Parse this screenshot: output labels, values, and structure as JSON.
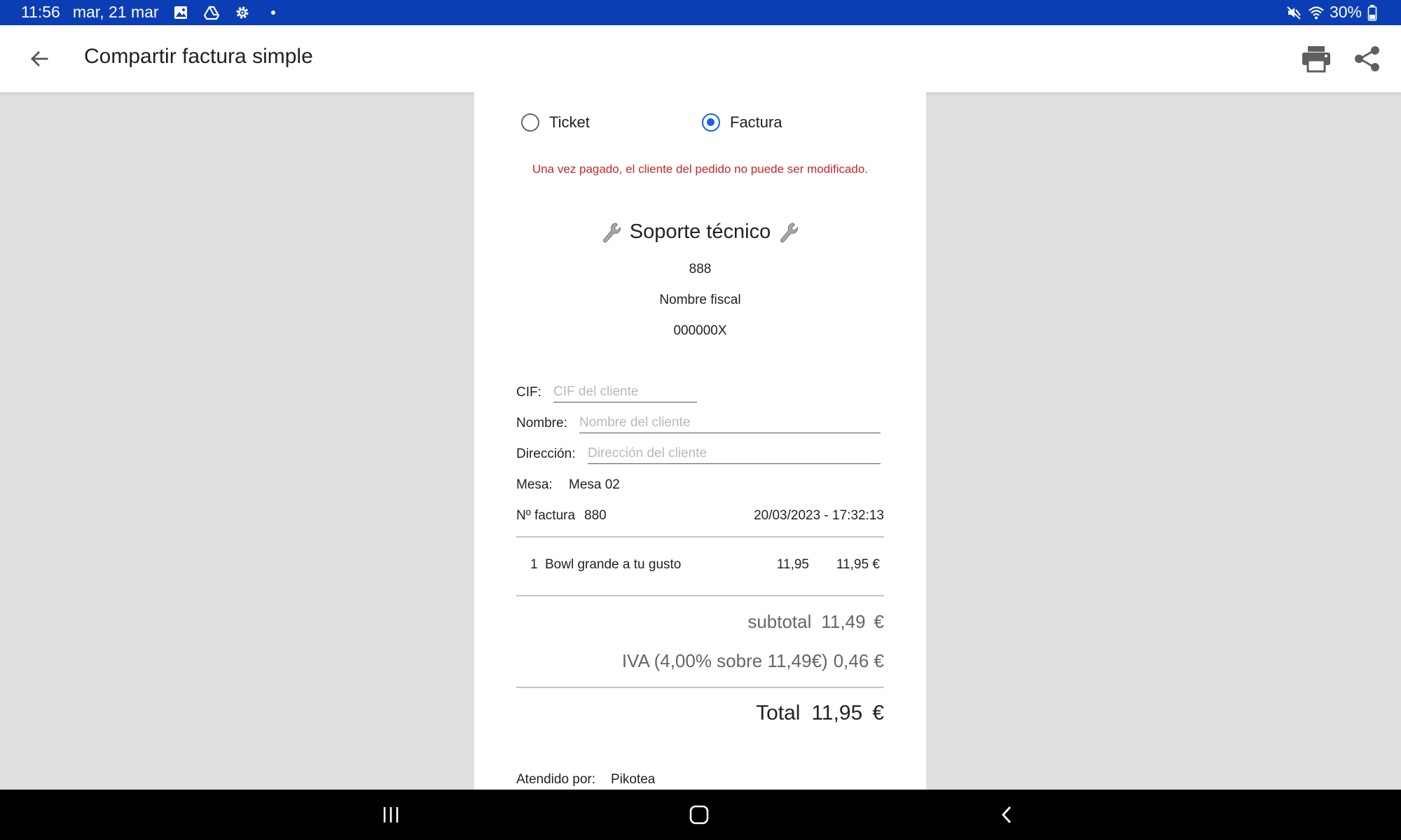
{
  "status_bar": {
    "time": "11:56",
    "date": "mar, 21 mar",
    "battery": "30%",
    "icons": [
      "image-icon",
      "drive-icon",
      "settings-icon",
      "dot-icon",
      "mute-icon",
      "wifi-icon",
      "battery-icon"
    ]
  },
  "app_bar": {
    "title": "Compartir factura simple",
    "back_icon": "arrow-back-icon",
    "print_icon": "print-icon",
    "share_icon": "share-icon"
  },
  "receipt": {
    "type_options": [
      {
        "label": "Ticket",
        "selected": false
      },
      {
        "label": "Factura",
        "selected": true
      }
    ],
    "warning": "Una vez pagado, el cliente del pedido no puede ser modificado.",
    "business_name": "Soporte técnico",
    "business_icon": "wrench-icon",
    "business_code": "888",
    "fiscal_name": "Nombre fiscal",
    "tax_id": "000000X",
    "fields": {
      "cif_label": "CIF:",
      "cif_placeholder": "CIF del cliente",
      "cif_value": "",
      "name_label": "Nombre:",
      "name_placeholder": "Nombre del cliente",
      "name_value": "",
      "address_label": "Dirección:",
      "address_placeholder": "Dirección del cliente",
      "address_value": ""
    },
    "table_label": "Mesa:",
    "table_value": "Mesa 02",
    "invoice_label": "Nº factura",
    "invoice_number": "880",
    "datetime": "20/03/2023 - 17:32:13",
    "items": [
      {
        "qty": "1",
        "name": "Bowl grande a tu gusto",
        "unit_price": "11,95",
        "total": "11,95 €"
      }
    ],
    "subtotal_label": "subtotal",
    "subtotal_value": "11,49",
    "currency": "€",
    "tax_label": "IVA (4,00% sobre 11,49€)",
    "tax_value": "0,46 €",
    "total_label": "Total",
    "total_value": "11,95",
    "served_by_label": "Atendido por:",
    "served_by_value": "Pikotea"
  },
  "nav_bar": {
    "recents_icon": "recents-icon",
    "home_icon": "home-icon",
    "back_icon": "nav-back-icon"
  },
  "colors": {
    "status_bar": "#0b3eb4",
    "accent": "#1565e0",
    "warning": "#c62828",
    "background": "#e0e0e0"
  }
}
